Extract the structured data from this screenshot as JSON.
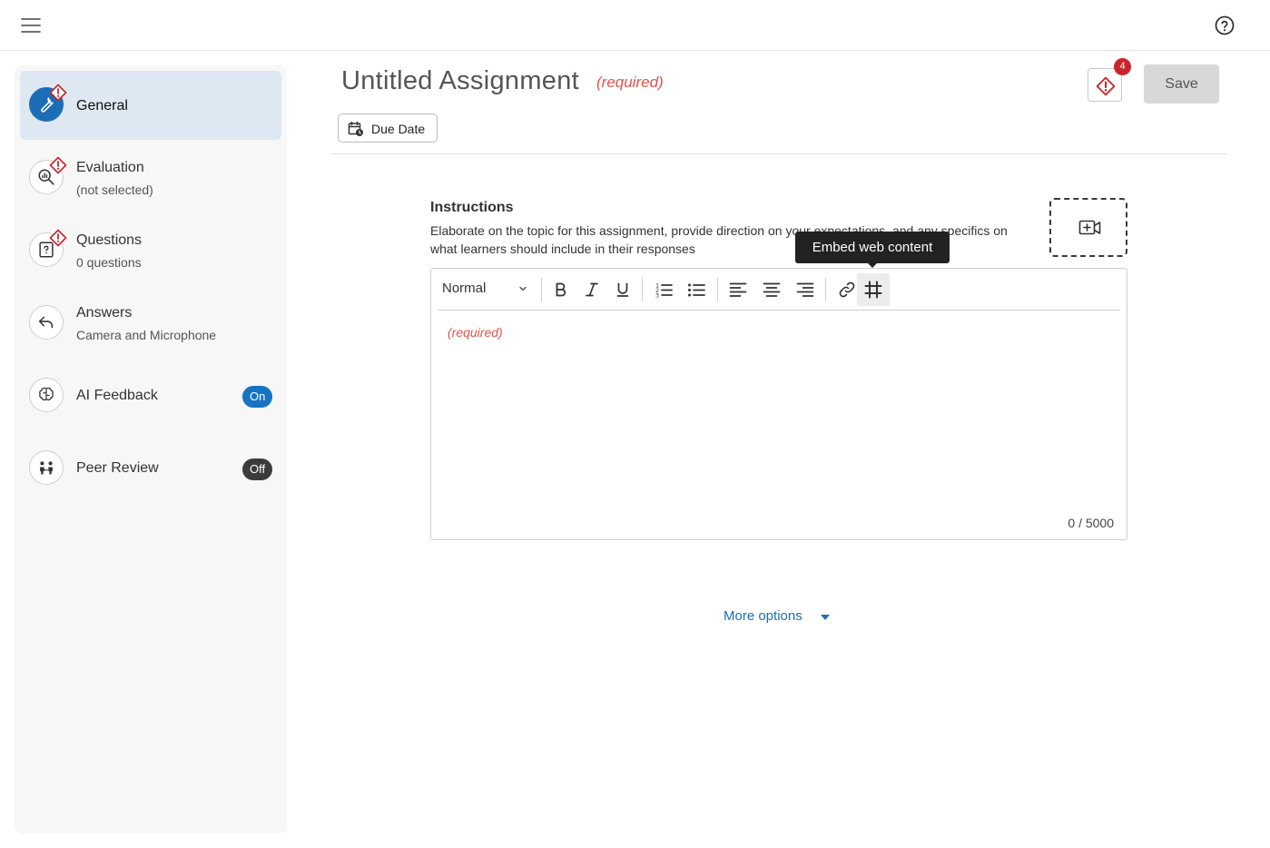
{
  "colors": {
    "accent": "#1b6eb6",
    "required": "#e0534a",
    "warning": "#c9252c",
    "on_pill": "#1773c4",
    "off_pill": "#3c3c3c"
  },
  "header": {
    "menu_icon": "hamburger-icon",
    "help_icon": "help-circle-icon"
  },
  "sidebar": {
    "items": [
      {
        "title": "General",
        "subtitle": "",
        "icon": "wrench-icon",
        "warning": true,
        "active": true
      },
      {
        "title": "Evaluation",
        "subtitle": "(not selected)",
        "icon": "magnifier-chart-icon",
        "warning": true
      },
      {
        "title": "Questions",
        "subtitle": "0 questions",
        "icon": "question-doc-icon",
        "warning": true
      },
      {
        "title": "Answers",
        "subtitle": "Camera and Microphone",
        "icon": "reply-arrow-icon",
        "warning": false
      },
      {
        "title": "AI Feedback",
        "subtitle": "",
        "icon": "brain-icon",
        "badge": "On"
      },
      {
        "title": "Peer Review",
        "subtitle": "",
        "icon": "people-icon",
        "badge": "Off"
      }
    ]
  },
  "main": {
    "title": "Untitled Assignment",
    "title_required": "(required)",
    "due_date_label": "Due Date",
    "issues_count": "4",
    "save_label": "Save",
    "instructions": {
      "label": "Instructions",
      "help": "Elaborate on the topic for this assignment, provide direction on your expectations, and any specifics on what learners should include in their responses"
    },
    "editor": {
      "format_select": "Normal",
      "placeholder": "(required)",
      "counter": "0 / 5000",
      "tooltip": "Embed web content"
    },
    "more_options": "More options"
  }
}
